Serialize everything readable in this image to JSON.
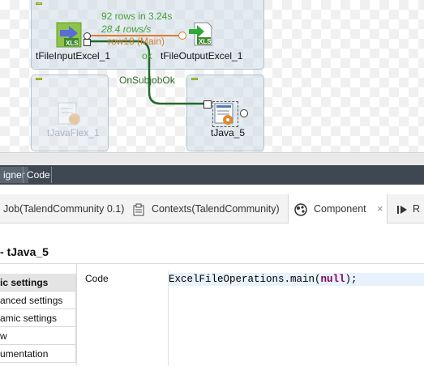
{
  "canvas": {
    "components": {
      "input": {
        "label": "tFileInputExcel_1",
        "icon": "excel-input-icon",
        "badge": "XLS"
      },
      "output": {
        "label": "tFileOutputExcel_1",
        "icon": "excel-output-icon",
        "badge": "XLS"
      },
      "flex": {
        "label": "tJavaFlex_1",
        "icon": "java-flex-icon",
        "disabled": true
      },
      "java": {
        "label": "tJava_5",
        "icon": "java-icon"
      }
    },
    "main_link": {
      "stats_rows": "92 rows in 3.24s",
      "stats_rate": "28.4 rows/s",
      "name": "row18 (Main)"
    },
    "ok_label": "ok",
    "trigger_label": "OnSubjobOk"
  },
  "editor_tabs": [
    {
      "label": "igner",
      "active": true
    },
    {
      "label": "Code",
      "active": false
    }
  ],
  "views_tabs": [
    {
      "label": "Job(TalendCommunity 0.1)",
      "icon": null
    },
    {
      "label": "Contexts(TalendCommunity)",
      "icon": "contexts-icon"
    },
    {
      "label": "Component",
      "icon": "component-icon",
      "active": true,
      "close": "×"
    },
    {
      "label": "R",
      "icon": "run-icon"
    }
  ],
  "component_panel": {
    "title": "tJava_5",
    "nav": [
      {
        "label": "ic settings",
        "active": true
      },
      {
        "label": "anced settings"
      },
      {
        "label": "amic settings"
      },
      {
        "label": "w"
      },
      {
        "label": "umentation"
      }
    ],
    "code_label": "Code",
    "code": {
      "prefix": "ExcelFileOperations.main(",
      "keyword": "null",
      "suffix": ");"
    }
  },
  "colors": {
    "subjob_bg": "#cddce8",
    "main_link": "#e07a30",
    "trigger_link": "#2d7a2d",
    "editor_tabs_bg": "#3f4750",
    "keyword": "#7f0055"
  }
}
